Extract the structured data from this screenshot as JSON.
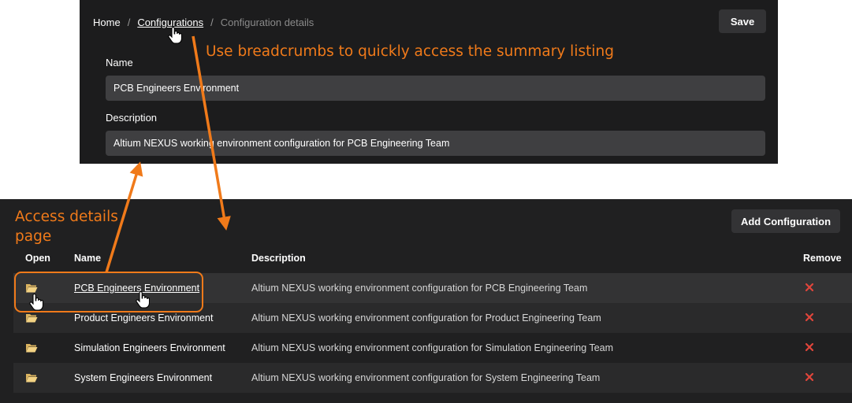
{
  "breadcrumb": {
    "home": "Home",
    "separator": "/",
    "configurations": "Configurations",
    "current": "Configuration details"
  },
  "details": {
    "save_label": "Save",
    "name_label": "Name",
    "name_value": "PCB Engineers Environment",
    "description_label": "Description",
    "description_value": "Altium NEXUS working environment configuration for PCB Engineering Team"
  },
  "list": {
    "add_label": "Add Configuration",
    "columns": {
      "open": "Open",
      "name": "Name",
      "description": "Description",
      "remove": "Remove"
    },
    "rows": [
      {
        "name": "PCB Engineers Environment",
        "description": "Altium NEXUS working environment configuration for PCB Engineering Team"
      },
      {
        "name": "Product Engineers Environment",
        "description": "Altium NEXUS working environment configuration for Product Engineering Team"
      },
      {
        "name": "Simulation Engineers Environment",
        "description": "Altium NEXUS working environment configuration for Simulation Engineering Team"
      },
      {
        "name": "System Engineers Environment",
        "description": "Altium NEXUS working environment configuration for System Engineering Team"
      }
    ]
  },
  "annotations": {
    "breadcrumbs_note": "Use breadcrumbs to quickly access the summary listing",
    "details_note_line1": "Access details",
    "details_note_line2": "page"
  },
  "colors": {
    "accent": "#f07a1a",
    "remove": "#e0453b",
    "folder": "#f3d283",
    "panel": "#1c1c1d"
  },
  "icons": [
    "folder-open-icon",
    "close-icon",
    "hand-pointer-icon"
  ]
}
